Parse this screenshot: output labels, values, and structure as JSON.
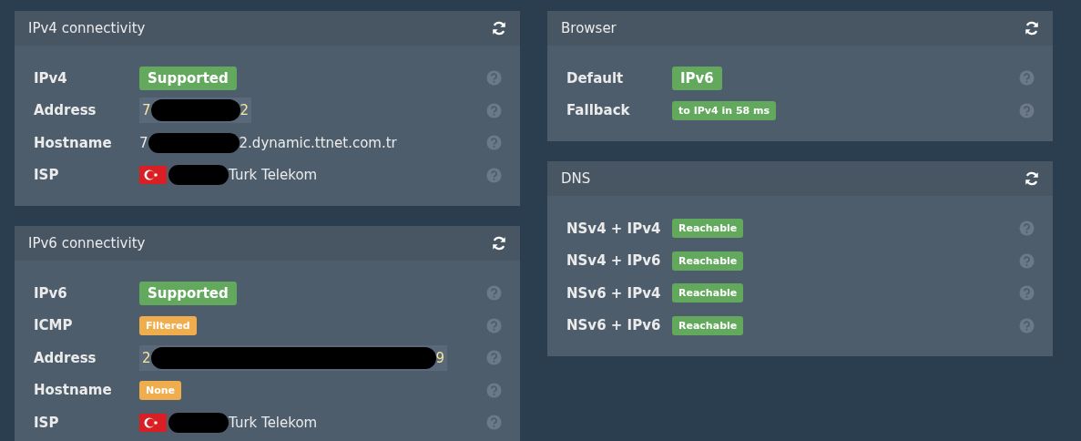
{
  "columns": [
    [
      {
        "title": "IPv4 connectivity",
        "rows": [
          {
            "label": "IPv4",
            "kind": "badge-large",
            "value": "Supported",
            "color": "#62a95e"
          },
          {
            "label": "Address",
            "kind": "address",
            "before": "7",
            "after": "2"
          },
          {
            "label": "Hostname",
            "kind": "hostname",
            "before": "7",
            "after": "2.dynamic.ttnet.com.tr"
          },
          {
            "label": "ISP",
            "kind": "isp",
            "after": "Turk Telekom"
          }
        ]
      },
      {
        "title": "IPv6 connectivity",
        "rows": [
          {
            "label": "IPv6",
            "kind": "badge-large",
            "value": "Supported",
            "color": "#62a95e"
          },
          {
            "label": "ICMP",
            "kind": "badge",
            "value": "Filtered",
            "color": "#f0ad4e"
          },
          {
            "label": "Address",
            "kind": "address",
            "before": "2",
            "after": "9",
            "long": true
          },
          {
            "label": "Hostname",
            "kind": "badge",
            "value": "None",
            "color": "#f0ad4e"
          },
          {
            "label": "ISP",
            "kind": "isp",
            "after": "Turk Telekom"
          }
        ]
      }
    ],
    [
      {
        "title": "Browser",
        "rows": [
          {
            "label": "Default",
            "kind": "badge-large",
            "value": "IPv6",
            "color": "#62a95e"
          },
          {
            "label": "Fallback",
            "kind": "badge",
            "value": "to IPv4 in 58 ms",
            "color": "#62a95e"
          }
        ]
      },
      {
        "title": "DNS",
        "rows": [
          {
            "label": "NSv4 + IPv4",
            "kind": "badge",
            "value": "Reachable",
            "color": "#62a95e"
          },
          {
            "label": "NSv4 + IPv6",
            "kind": "badge",
            "value": "Reachable",
            "color": "#62a95e"
          },
          {
            "label": "NSv6 + IPv4",
            "kind": "badge",
            "value": "Reachable",
            "color": "#62a95e"
          },
          {
            "label": "NSv6 + IPv6",
            "kind": "badge",
            "value": "Reachable",
            "color": "#62a95e"
          }
        ]
      }
    ]
  ]
}
